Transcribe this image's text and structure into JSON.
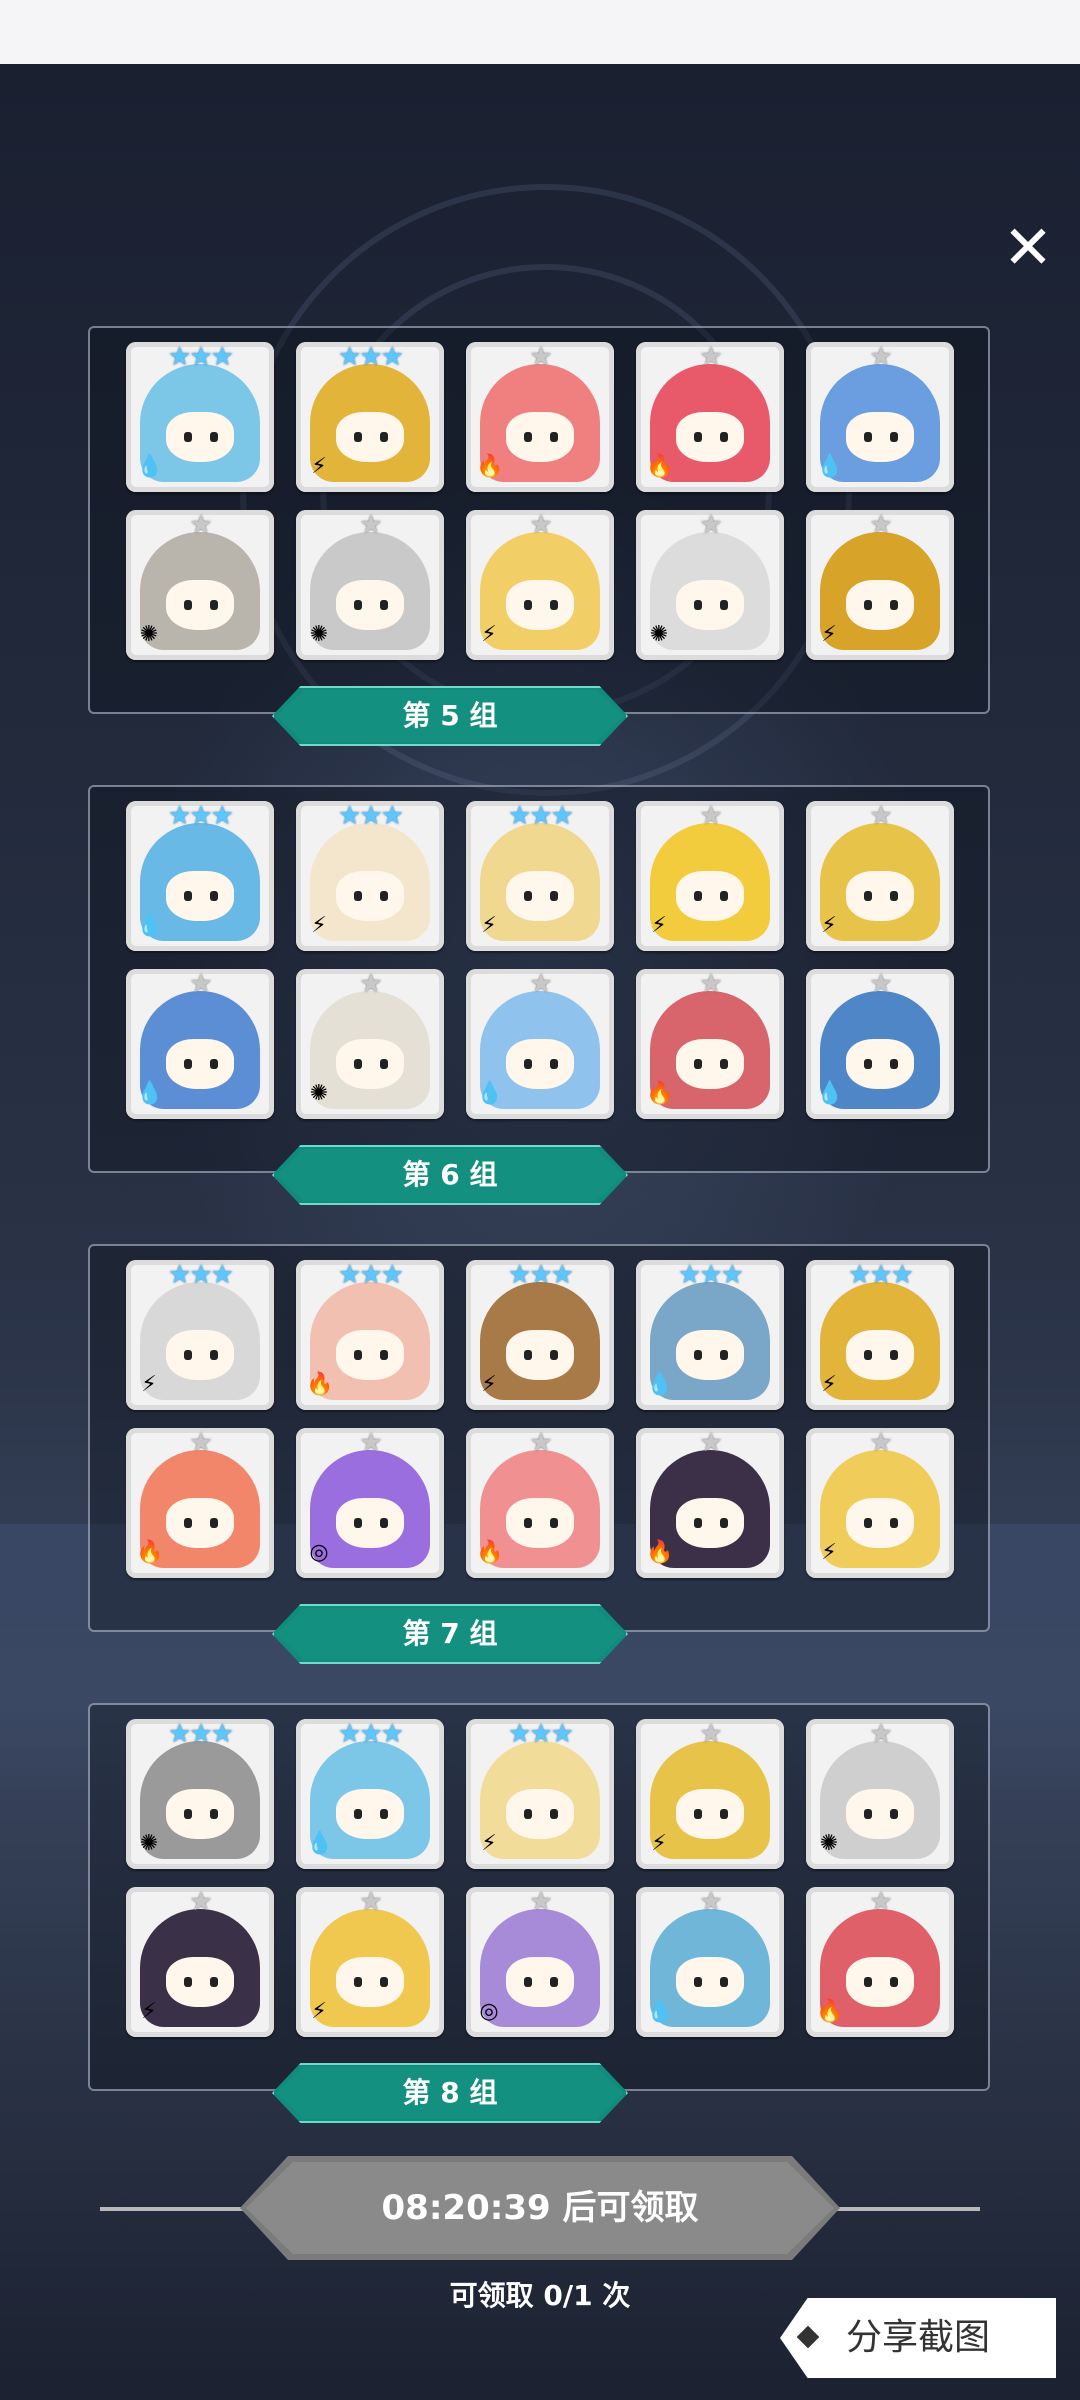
{
  "close_label": "✕",
  "groups": [
    {
      "label": "第 5 组",
      "cards": [
        {
          "stars": "★★★",
          "star_tier": "blue",
          "element_icon": "water-drop-icon",
          "element_glyph": "💧",
          "color": "#7cc6e8"
        },
        {
          "stars": "★★★",
          "star_tier": "blue",
          "element_icon": "lightning-icon",
          "element_glyph": "⚡",
          "color": "#e2b43a"
        },
        {
          "stars": "★",
          "star_tier": "gray",
          "element_icon": "fire-icon",
          "element_glyph": "🔥",
          "color": "#f08080"
        },
        {
          "stars": "★",
          "star_tier": "gray",
          "element_icon": "fire-icon",
          "element_glyph": "🔥",
          "color": "#e85a6a"
        },
        {
          "stars": "★",
          "star_tier": "gray",
          "element_icon": "water-drop-icon",
          "element_glyph": "💧",
          "color": "#6b9ee0"
        },
        {
          "stars": "★",
          "star_tier": "gray",
          "element_icon": "light-icon",
          "element_glyph": "✺",
          "color": "#b9b4ac"
        },
        {
          "stars": "★",
          "star_tier": "gray",
          "element_icon": "light-icon",
          "element_glyph": "✺",
          "color": "#c9c9c9"
        },
        {
          "stars": "★",
          "star_tier": "gray",
          "element_icon": "lightning-icon",
          "element_glyph": "⚡",
          "color": "#f2cf66"
        },
        {
          "stars": "★",
          "star_tier": "gray",
          "element_icon": "light-icon",
          "element_glyph": "✺",
          "color": "#dcdcdc"
        },
        {
          "stars": "★",
          "star_tier": "gray",
          "element_icon": "lightning-icon",
          "element_glyph": "⚡",
          "color": "#d7a328"
        }
      ]
    },
    {
      "label": "第 6 组",
      "cards": [
        {
          "stars": "★★★",
          "star_tier": "blue",
          "element_icon": "water-drop-icon",
          "element_glyph": "💧",
          "color": "#69b9e6"
        },
        {
          "stars": "★★★",
          "star_tier": "blue",
          "element_icon": "lightning-icon",
          "element_glyph": "⚡",
          "color": "#f4e6cc"
        },
        {
          "stars": "★★★",
          "star_tier": "blue",
          "element_icon": "lightning-icon",
          "element_glyph": "⚡",
          "color": "#f0d890"
        },
        {
          "stars": "★",
          "star_tier": "gray",
          "element_icon": "lightning-icon",
          "element_glyph": "⚡",
          "color": "#f2cc3c"
        },
        {
          "stars": "★",
          "star_tier": "gray",
          "element_icon": "lightning-icon",
          "element_glyph": "⚡",
          "color": "#e8c34a"
        },
        {
          "stars": "★",
          "star_tier": "gray",
          "element_icon": "water-drop-icon",
          "element_glyph": "💧",
          "color": "#5c8ed6"
        },
        {
          "stars": "★",
          "star_tier": "gray",
          "element_icon": "light-icon",
          "element_glyph": "✺",
          "color": "#e4e0d6"
        },
        {
          "stars": "★",
          "star_tier": "gray",
          "element_icon": "water-drop-icon",
          "element_glyph": "💧",
          "color": "#8fc3ee"
        },
        {
          "stars": "★",
          "star_tier": "gray",
          "element_icon": "fire-icon",
          "element_glyph": "🔥",
          "color": "#d8646c"
        },
        {
          "stars": "★",
          "star_tier": "gray",
          "element_icon": "water-drop-icon",
          "element_glyph": "💧",
          "color": "#4f86c8"
        }
      ]
    },
    {
      "label": "第 7 组",
      "cards": [
        {
          "stars": "★★★",
          "star_tier": "blue",
          "element_icon": "lightning-icon",
          "element_glyph": "⚡",
          "color": "#d8d8d8"
        },
        {
          "stars": "★★★",
          "star_tier": "blue",
          "element_icon": "fire-icon",
          "element_glyph": "🔥",
          "color": "#f2c0b0"
        },
        {
          "stars": "★★★",
          "star_tier": "blue",
          "element_icon": "lightning-icon",
          "element_glyph": "⚡",
          "color": "#a77a48"
        },
        {
          "stars": "★★★",
          "star_tier": "blue",
          "element_icon": "water-drop-icon",
          "element_glyph": "💧",
          "color": "#7aa6c8"
        },
        {
          "stars": "★★★",
          "star_tier": "blue",
          "element_icon": "lightning-icon",
          "element_glyph": "⚡",
          "color": "#e2b43a"
        },
        {
          "stars": "★",
          "star_tier": "gray",
          "element_icon": "fire-icon",
          "element_glyph": "🔥",
          "color": "#f2866a"
        },
        {
          "stars": "★",
          "star_tier": "gray",
          "element_icon": "arcane-icon",
          "element_glyph": "◎",
          "color": "#9b6ee0"
        },
        {
          "stars": "★",
          "star_tier": "gray",
          "element_icon": "fire-icon",
          "element_glyph": "🔥",
          "color": "#f09090"
        },
        {
          "stars": "★",
          "star_tier": "gray",
          "element_icon": "fire-icon",
          "element_glyph": "🔥",
          "color": "#3c3048"
        },
        {
          "stars": "★",
          "star_tier": "gray",
          "element_icon": "lightning-icon",
          "element_glyph": "⚡",
          "color": "#f0cc5a"
        }
      ]
    },
    {
      "label": "第 8 组",
      "cards": [
        {
          "stars": "★★★",
          "star_tier": "blue",
          "element_icon": "light-icon",
          "element_glyph": "✺",
          "color": "#9a9a9a"
        },
        {
          "stars": "★★★",
          "star_tier": "blue",
          "element_icon": "water-drop-icon",
          "element_glyph": "💧",
          "color": "#7cc6e8"
        },
        {
          "stars": "★★★",
          "star_tier": "blue",
          "element_icon": "lightning-icon",
          "element_glyph": "⚡",
          "color": "#f2dc9a"
        },
        {
          "stars": "★",
          "star_tier": "gray",
          "element_icon": "lightning-icon",
          "element_glyph": "⚡",
          "color": "#e8c34a"
        },
        {
          "stars": "★",
          "star_tier": "gray",
          "element_icon": "light-icon",
          "element_glyph": "✺",
          "color": "#cfcfcf"
        },
        {
          "stars": "★",
          "star_tier": "gray",
          "element_icon": "lightning-icon",
          "element_glyph": "⚡",
          "color": "#3a3048"
        },
        {
          "stars": "★",
          "star_tier": "gray",
          "element_icon": "lightning-icon",
          "element_glyph": "⚡",
          "color": "#f0c850"
        },
        {
          "stars": "★",
          "star_tier": "gray",
          "element_icon": "arcane-icon",
          "element_glyph": "◎",
          "color": "#a78ad8"
        },
        {
          "stars": "★",
          "star_tier": "gray",
          "element_icon": "water-drop-icon",
          "element_glyph": "💧",
          "color": "#6fb6d8"
        },
        {
          "stars": "★",
          "star_tier": "gray",
          "element_icon": "fire-icon",
          "element_glyph": "🔥",
          "color": "#e0606a"
        }
      ]
    }
  ],
  "claim": {
    "button_label": "08:20:39 后可领取",
    "count_text": "可领取 0/1 次"
  },
  "share": {
    "label": "分享截图"
  }
}
